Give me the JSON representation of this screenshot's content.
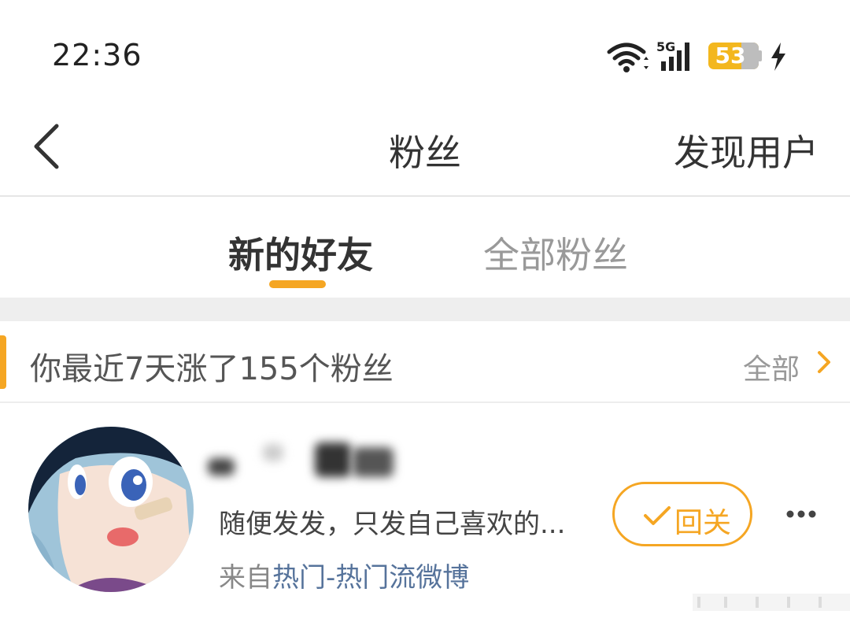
{
  "status_bar": {
    "time": "22:36",
    "network_label": "5G",
    "battery_level": "53",
    "battery_color": "#f3b71e",
    "icons": [
      "wifi-icon",
      "signal-icon",
      "battery-icon",
      "charging-icon"
    ]
  },
  "nav": {
    "back_icon": "chevron-left-icon",
    "title": "粉丝",
    "right_action": "发现用户"
  },
  "tabs": [
    {
      "label": "新的好友",
      "active": true
    },
    {
      "label": "全部粉丝",
      "active": false
    }
  ],
  "section": {
    "title": "你最近7天涨了155个粉丝",
    "more_label": "全部",
    "more_icon": "chevron-right-icon"
  },
  "users": [
    {
      "bio": "随便发发，只发自己喜欢的...",
      "source_prefix": "来自",
      "source_link": "热门-热门流微博",
      "follow_label": "回关",
      "follow_icon": "check-icon",
      "more_icon": "more-dots-icon"
    }
  ],
  "colors": {
    "accent": "#f5a623",
    "link": "#56739b",
    "text_primary": "#333333",
    "text_secondary": "#999999"
  }
}
